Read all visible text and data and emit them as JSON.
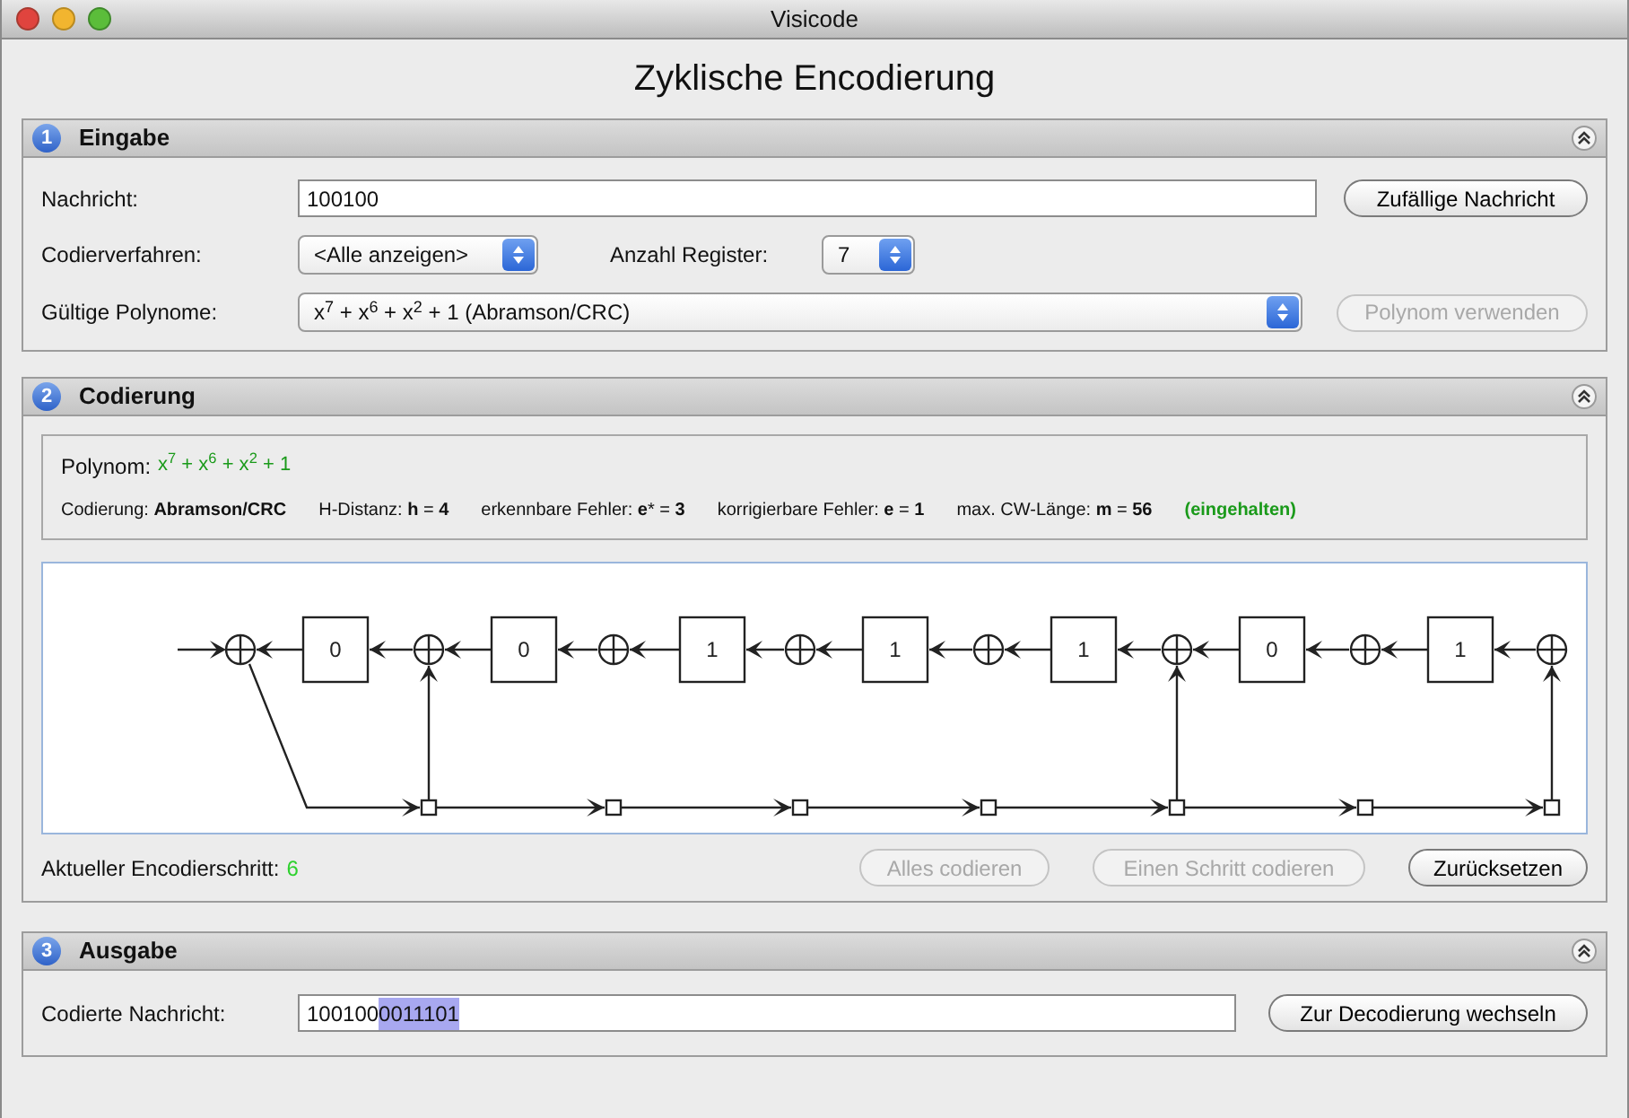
{
  "window": {
    "title": "Visicode"
  },
  "heading": "Zyklische Encodierung",
  "input_section": {
    "number": "1",
    "title": "Eingabe",
    "message": {
      "label": "Nachricht:",
      "value": "100100",
      "button": {
        "label": "Zufällige Nachricht",
        "disabled": false
      }
    },
    "method": {
      "label": "Codierverfahren:",
      "value": "<Alle anzeigen>"
    },
    "registers": {
      "label": "Anzahl Register:",
      "value": "7"
    },
    "polynomials": {
      "label": "Gültige Polynome:",
      "value": "x$^{7}$ + x$^{6}$ + x$^{2}$ + 1 (Abramson/CRC)",
      "button": {
        "label": "Polynom verwenden",
        "disabled": true
      }
    }
  },
  "coding_section": {
    "number": "2",
    "title": "Codierung",
    "polynomial": {
      "label": "Polynom:",
      "value": "x$^{7}$ + x$^{6}$ + x$^{2}$ + 1"
    },
    "properties": [
      "Codierung: **Abramson/CRC**",
      "H-Distanz: **h** = **4**",
      "erkennbare Fehler: **e*** = **3**",
      "korrigierbare Fehler: **e** = **1**",
      "max. CW-Länge: **m** = **56**"
    ],
    "limit_status": "(eingehalten)",
    "diagram": {
      "registers": [
        {
          "value": "0"
        },
        {
          "value": "0"
        },
        {
          "value": "1"
        },
        {
          "value": "1"
        },
        {
          "value": "1"
        },
        {
          "value": "0"
        },
        {
          "value": "1"
        }
      ],
      "taps": [
        {
          "on": true
        },
        {
          "on": false
        },
        {
          "on": false
        },
        {
          "on": false
        },
        {
          "on": true
        },
        {
          "on": false
        },
        {
          "on": true
        }
      ]
    },
    "step": {
      "label": "Aktueller Encodierschritt:",
      "value": "6"
    },
    "buttons": [
      {
        "label": "Alles codieren",
        "disabled": true
      },
      {
        "label": "Einen Schritt codieren",
        "disabled": true
      },
      {
        "label": "Zurücksetzen",
        "disabled": false
      }
    ]
  },
  "output_section": {
    "number": "3",
    "title": "Ausgabe",
    "encoded": {
      "label": "Codierte Nachricht:",
      "text": "100100",
      "highlighted": "0011101"
    },
    "button": {
      "label": "Zur Decodierung wechseln",
      "disabled": false
    }
  }
}
